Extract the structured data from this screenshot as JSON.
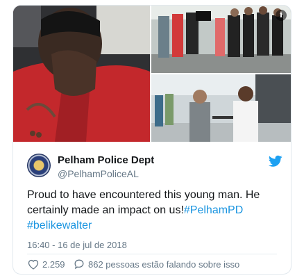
{
  "tweet": {
    "author_name": "Pelham Police Dept",
    "author_handle": "@PelhamPoliceAL",
    "text_part1": "Proud to have encountered this young man. He certainly made an impact on us!",
    "hashtag1": "#PelhamPD",
    "hashtag2": "#belikewalter",
    "timestamp": "16:40 - 16 de jul de 2018",
    "likes": "2.259",
    "replies_text": "862 pessoas estão falando sobre isso"
  },
  "media": {
    "info_glyph": "i"
  },
  "icons": {
    "bird": "twitter-bird-icon",
    "heart": "heart-icon",
    "reply": "speech-bubble-icon",
    "info": "info-icon"
  },
  "colors": {
    "link": "#1b95e0",
    "text": "#14171a",
    "muted": "#657786",
    "brand": "#1da1f2"
  }
}
